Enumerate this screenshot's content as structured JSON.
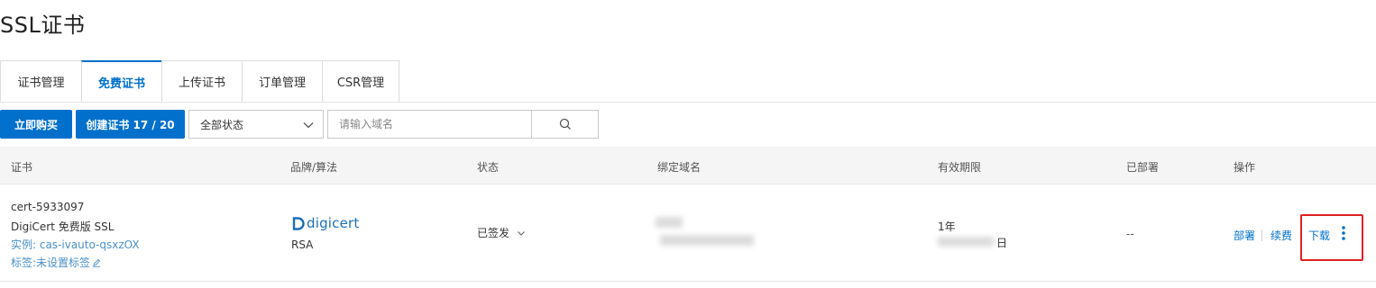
{
  "page": {
    "title": "SSL证书"
  },
  "tabs": [
    {
      "label": "证书管理",
      "active": false
    },
    {
      "label": "免费证书",
      "active": true
    },
    {
      "label": "上传证书",
      "active": false
    },
    {
      "label": "订单管理",
      "active": false
    },
    {
      "label": "CSR管理",
      "active": false
    }
  ],
  "toolbar": {
    "buy_label": "立即购买",
    "create_label": "创建证书 17 / 20",
    "status_select": "全部状态",
    "search_placeholder": "请输入域名"
  },
  "table": {
    "headers": {
      "cert": "证书",
      "brand": "品牌/算法",
      "status": "状态",
      "domain": "绑定域名",
      "validity": "有效期限",
      "deployed": "已部署",
      "actions": "操作"
    },
    "rows": [
      {
        "cert_id": "cert-5933097",
        "cert_name": "DigiCert 免费版 SSL",
        "instance": "实例: cas-ivauto-qsxzOX",
        "tag": "标签:未设置标签",
        "brand_logo": "digicert",
        "algorithm": "RSA",
        "status": "已签发",
        "validity_period": "1年",
        "validity_date_suffix": "日",
        "deployed": "--",
        "actions": {
          "deploy": "部署",
          "renew": "续费",
          "download": "下载"
        }
      }
    ]
  },
  "icons": {
    "search": "search-icon",
    "chevron": "chevron-down-icon",
    "edit": "edit-icon",
    "more": "more-vertical-icon"
  },
  "colors": {
    "primary": "#0070cc",
    "highlight_border": "#e02020",
    "header_bg": "#f5f5f6",
    "logo_blue": "#1a6fb8"
  }
}
